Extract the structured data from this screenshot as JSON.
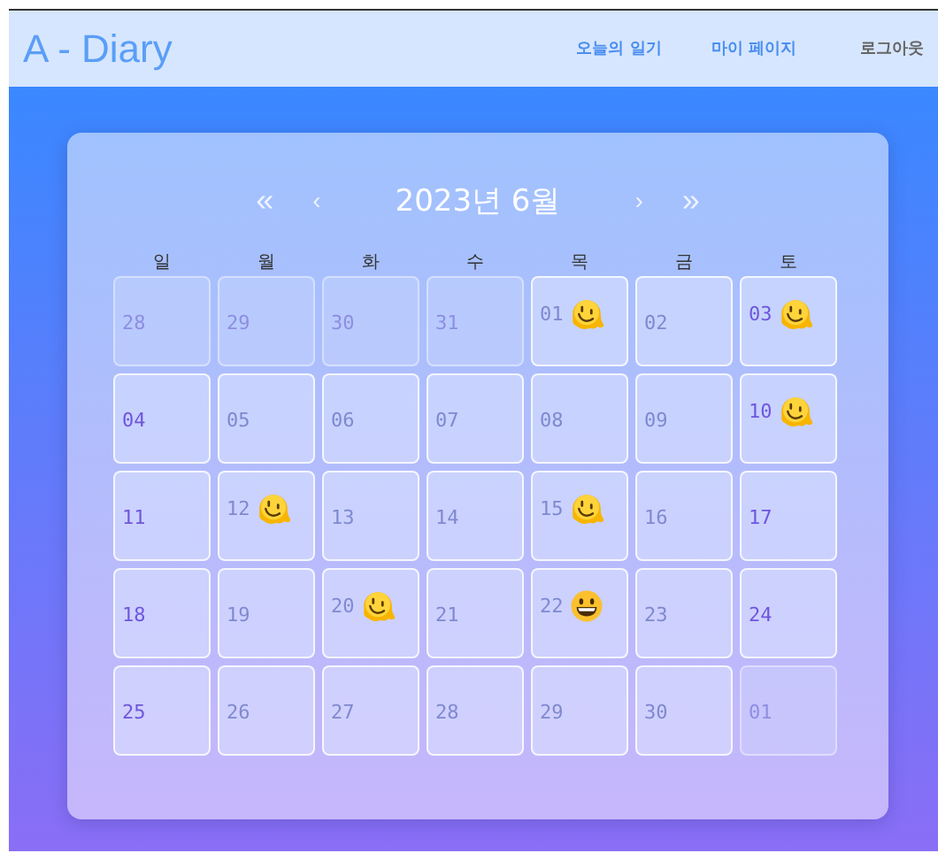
{
  "header": {
    "logo": "A - Diary",
    "nav": [
      {
        "label": "오늘의 일기",
        "kind": "primary"
      },
      {
        "label": "마이 페이지",
        "kind": "primary"
      },
      {
        "label": "로그아웃",
        "kind": "muted"
      }
    ]
  },
  "calendar": {
    "prev_year": "«",
    "prev_month": "‹",
    "title": "2023년 6월",
    "next_month": "›",
    "next_year": "»",
    "weekdays": [
      "일",
      "월",
      "화",
      "수",
      "목",
      "금",
      "토"
    ],
    "days": [
      {
        "day": "28",
        "kind": "outside"
      },
      {
        "day": "29",
        "kind": "outside"
      },
      {
        "day": "30",
        "kind": "outside"
      },
      {
        "day": "31",
        "kind": "outside"
      },
      {
        "day": "01",
        "kind": "weekday",
        "sticker": {
          "kind": "melting"
        }
      },
      {
        "day": "02",
        "kind": "weekday"
      },
      {
        "day": "03",
        "kind": "weekend",
        "sticker": {
          "kind": "melting"
        }
      },
      {
        "day": "04",
        "kind": "weekend"
      },
      {
        "day": "05",
        "kind": "weekday"
      },
      {
        "day": "06",
        "kind": "weekday"
      },
      {
        "day": "07",
        "kind": "weekday"
      },
      {
        "day": "08",
        "kind": "weekday"
      },
      {
        "day": "09",
        "kind": "weekday"
      },
      {
        "day": "10",
        "kind": "weekend",
        "sticker": {
          "kind": "melting"
        }
      },
      {
        "day": "11",
        "kind": "weekend"
      },
      {
        "day": "12",
        "kind": "weekday",
        "sticker": {
          "kind": "melting"
        }
      },
      {
        "day": "13",
        "kind": "weekday"
      },
      {
        "day": "14",
        "kind": "weekday"
      },
      {
        "day": "15",
        "kind": "weekday",
        "sticker": {
          "kind": "melting"
        }
      },
      {
        "day": "16",
        "kind": "weekday"
      },
      {
        "day": "17",
        "kind": "weekend"
      },
      {
        "day": "18",
        "kind": "weekend"
      },
      {
        "day": "19",
        "kind": "weekday"
      },
      {
        "day": "20",
        "kind": "weekday",
        "sticker": {
          "kind": "melting"
        }
      },
      {
        "day": "21",
        "kind": "weekday"
      },
      {
        "day": "22",
        "kind": "weekday",
        "sticker": {
          "kind": "grin"
        }
      },
      {
        "day": "23",
        "kind": "weekday"
      },
      {
        "day": "24",
        "kind": "weekend"
      },
      {
        "day": "25",
        "kind": "weekend"
      },
      {
        "day": "26",
        "kind": "weekday"
      },
      {
        "day": "27",
        "kind": "weekday"
      },
      {
        "day": "28",
        "kind": "weekday"
      },
      {
        "day": "29",
        "kind": "weekday"
      },
      {
        "day": "30",
        "kind": "weekday"
      },
      {
        "day": "01",
        "kind": "outside"
      }
    ]
  }
}
